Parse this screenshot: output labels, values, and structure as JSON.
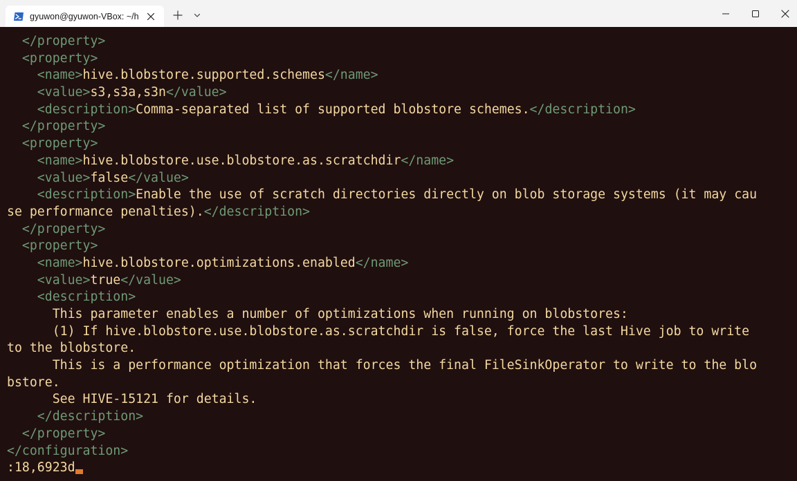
{
  "window": {
    "tab_title": "gyuwon@gyuwon-VBox: ~/h",
    "icons": {
      "tab_icon": "powershell-terminal-icon",
      "tab_close": "close-icon",
      "new_tab": "plus-icon",
      "tab_menu": "chevron-down-icon",
      "minimize": "minimize-icon",
      "maximize": "maximize-icon",
      "close": "close-icon"
    }
  },
  "colors": {
    "background": "#200f0f",
    "tag": "#6e9a76",
    "text": "#f4d9a0",
    "cursor": "#e07a2e"
  },
  "terminal": {
    "lines": [
      [
        {
          "t": "tag",
          "s": "  </property>"
        }
      ],
      [
        {
          "t": "tag",
          "s": "  <property>"
        }
      ],
      [
        {
          "t": "tag",
          "s": "    <name>"
        },
        {
          "t": "txt",
          "s": "hive.blobstore.supported.schemes"
        },
        {
          "t": "tag",
          "s": "</name>"
        }
      ],
      [
        {
          "t": "tag",
          "s": "    <value>"
        },
        {
          "t": "txt",
          "s": "s3,s3a,s3n"
        },
        {
          "t": "tag",
          "s": "</value>"
        }
      ],
      [
        {
          "t": "tag",
          "s": "    <description>"
        },
        {
          "t": "txt",
          "s": "Comma-separated list of supported blobstore schemes."
        },
        {
          "t": "tag",
          "s": "</description>"
        }
      ],
      [
        {
          "t": "tag",
          "s": "  </property>"
        }
      ],
      [
        {
          "t": "tag",
          "s": "  <property>"
        }
      ],
      [
        {
          "t": "tag",
          "s": "    <name>"
        },
        {
          "t": "txt",
          "s": "hive.blobstore.use.blobstore.as.scratchdir"
        },
        {
          "t": "tag",
          "s": "</name>"
        }
      ],
      [
        {
          "t": "tag",
          "s": "    <value>"
        },
        {
          "t": "txt",
          "s": "false"
        },
        {
          "t": "tag",
          "s": "</value>"
        }
      ],
      [
        {
          "t": "tag",
          "s": "    <description>"
        },
        {
          "t": "txt",
          "s": "Enable the use of scratch directories directly on blob storage systems (it may cau"
        }
      ],
      [
        {
          "t": "txt",
          "s": "se performance penalties)."
        },
        {
          "t": "tag",
          "s": "</description>"
        }
      ],
      [
        {
          "t": "tag",
          "s": "  </property>"
        }
      ],
      [
        {
          "t": "tag",
          "s": "  <property>"
        }
      ],
      [
        {
          "t": "tag",
          "s": "    <name>"
        },
        {
          "t": "txt",
          "s": "hive.blobstore.optimizations.enabled"
        },
        {
          "t": "tag",
          "s": "</name>"
        }
      ],
      [
        {
          "t": "tag",
          "s": "    <value>"
        },
        {
          "t": "txt",
          "s": "true"
        },
        {
          "t": "tag",
          "s": "</value>"
        }
      ],
      [
        {
          "t": "tag",
          "s": "    <description>"
        }
      ],
      [
        {
          "t": "txt",
          "s": "      This parameter enables a number of optimizations when running on blobstores:"
        }
      ],
      [
        {
          "t": "txt",
          "s": "      (1) If hive.blobstore.use.blobstore.as.scratchdir is false, force the last Hive job to write"
        }
      ],
      [
        {
          "t": "txt",
          "s": "to the blobstore."
        }
      ],
      [
        {
          "t": "txt",
          "s": "      This is a performance optimization that forces the final FileSinkOperator to write to the blo"
        }
      ],
      [
        {
          "t": "txt",
          "s": "bstore."
        }
      ],
      [
        {
          "t": "txt",
          "s": "      See HIVE-15121 for details."
        }
      ],
      [
        {
          "t": "tag",
          "s": "    </description>"
        }
      ],
      [
        {
          "t": "tag",
          "s": "  </property>"
        }
      ],
      [
        {
          "t": "tag",
          "s": "</configuration>"
        }
      ]
    ],
    "command_line": ":18,6923d"
  }
}
